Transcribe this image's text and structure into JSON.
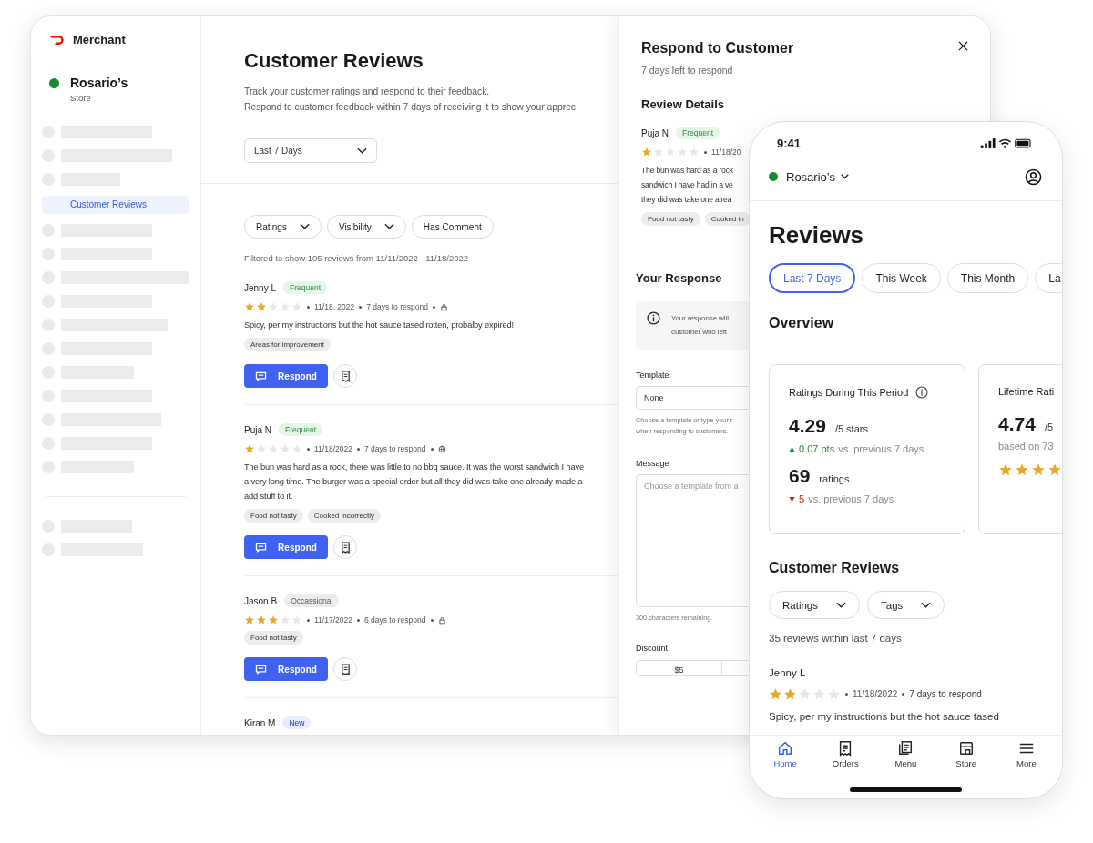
{
  "desktop": {
    "brand": "Merchant",
    "store": {
      "name": "Rosario’s",
      "subtitle": "Store"
    },
    "sidebar": [
      {
        "kind": "skeleton"
      },
      {
        "kind": "skeleton"
      },
      {
        "kind": "skeleton"
      },
      {
        "kind": "link",
        "label": "Customer Reviews",
        "selected": true
      },
      {
        "kind": "skeleton"
      },
      {
        "kind": "skeleton"
      },
      {
        "kind": "skeleton"
      },
      {
        "kind": "skeleton"
      },
      {
        "kind": "skeleton"
      },
      {
        "kind": "skeleton"
      },
      {
        "kind": "skeleton"
      },
      {
        "kind": "skeleton"
      },
      {
        "kind": "skeleton"
      },
      {
        "kind": "skeleton"
      },
      {
        "kind": "skeleton"
      },
      {
        "kind": "divider"
      },
      {
        "kind": "skeleton"
      },
      {
        "kind": "skeleton"
      }
    ],
    "page": {
      "title": "Customer Reviews",
      "description": [
        "Track your customer ratings and respond to their feedback.",
        "Respond to customer feedback within 7 days of receiving it to show your apprec"
      ],
      "period": "Last 7 Days",
      "filters": [
        {
          "label": "Ratings",
          "kind": "dropdown"
        },
        {
          "label": "Visibility",
          "kind": "dropdown"
        },
        {
          "label": "Has Comment",
          "kind": "toggle"
        }
      ],
      "summary": "Filtered to show 105 reviews from 11/11/2022 - 11/18/2022"
    },
    "reviews": [
      {
        "name": "Jenny L",
        "badge": {
          "label": "Frequent",
          "color": "#e3f6e8"
        },
        "stars": 2,
        "date": "11/18, 2022",
        "due": "7 days to respond",
        "public": false,
        "text": [
          "Spicy, per my instructions but the hot sauce tased rotten, probalby expired!"
        ],
        "tags": [
          "Areas for improvement"
        ],
        "action": "Respond"
      },
      {
        "name": "Puja N",
        "badge": {
          "label": "Frequent",
          "color": "#e3f6e8"
        },
        "stars": 1,
        "date": "11/18/2022",
        "due": "7 days to respond",
        "public": true,
        "text": [
          "The bun was hard as a rock, there was little to no bbq sauce. It was the worst sandwich I have",
          "a very long time. The burger was a special order but all they did was take one already made a",
          "add stuff to it."
        ],
        "tags": [
          "Food not tasty",
          "Cooked incorrectly"
        ],
        "action": "Respond"
      },
      {
        "name": "Jason B",
        "badge": {
          "label": "Occassional",
          "color": "#ebebeb"
        },
        "stars": 3,
        "date": "11/17/2022",
        "due": "6 days to respond",
        "public": false,
        "tags": [
          "Food not tasty"
        ],
        "action": "Respond"
      },
      {
        "name": "Kiran M",
        "badge": {
          "label": "New",
          "color": "#e9eefd"
        }
      }
    ]
  },
  "panel": {
    "title": "Respond to Customer",
    "subtitle": "7 days left to respond",
    "details_heading": "Review Details",
    "review": {
      "name": "Puja N",
      "badge": {
        "label": "Frequent",
        "color": "#e3f6e8"
      },
      "stars": 1,
      "date": "11/18/20",
      "text": [
        "The bun was hard as a rock",
        "sandwich I have had in a ve",
        "they did was take one alrea"
      ],
      "tags": [
        "Food not tasty",
        "Cooked in"
      ]
    },
    "response_heading": "Your Response",
    "info": [
      "Your response will",
      "customer who left"
    ],
    "template_label": "Template",
    "template_value": "None",
    "template_hint": [
      "Choose a template or type your r",
      "when responding to customers."
    ],
    "message_label": "Message",
    "message_placeholder": "Choose a template from a",
    "remaining": "300 characters remaining.",
    "discount_label": "Discount",
    "discounts": [
      "$5"
    ]
  },
  "phone": {
    "time": "9:41",
    "store": "Rosario’s",
    "title": "Reviews",
    "periods": [
      {
        "label": "Last 7 Days",
        "selected": true
      },
      {
        "label": "This Week",
        "selected": false
      },
      {
        "label": "This Month",
        "selected": false
      },
      {
        "label": "La",
        "selected": false
      }
    ],
    "overview_heading": "Overview",
    "period_card": {
      "title": "Ratings During This Period",
      "value": "4.29",
      "unit": "/5 stars",
      "change": {
        "increased": true,
        "value": "0.07 pts",
        "text": "vs. previous 7 days"
      },
      "count": "69",
      "count_unit": "ratings",
      "count_change": {
        "increased": false,
        "value": "5",
        "text": "vs. previous 7 days"
      }
    },
    "lifetime_card": {
      "title": "Lifetime Rati",
      "value": "4.74",
      "unit": "/5",
      "note": "based on 73",
      "stars": 4
    },
    "reviews_heading": "Customer Reviews",
    "filters": [
      "Ratings",
      "Tags"
    ],
    "summary": "35 reviews within last 7 days",
    "review": {
      "name": "Jenny L",
      "stars": 2,
      "date": "11/18/2022",
      "due": "7 days to respond",
      "text": "Spicy, per my instructions but the hot sauce tased"
    },
    "tabs": [
      {
        "label": "Home",
        "kind": "home",
        "selected": true
      },
      {
        "label": "Orders",
        "kind": "orders",
        "selected": false
      },
      {
        "label": "Menu",
        "kind": "menu",
        "selected": false
      },
      {
        "label": "Store",
        "kind": "store",
        "selected": false
      },
      {
        "label": "More",
        "kind": "more",
        "selected": false
      }
    ]
  }
}
